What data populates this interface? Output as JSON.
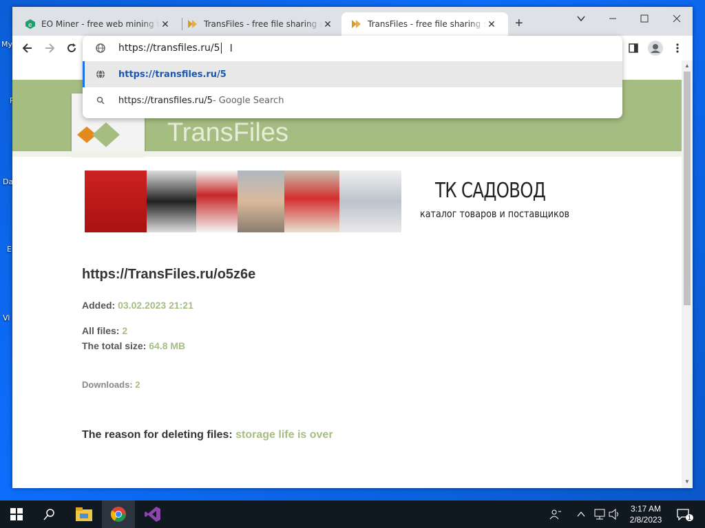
{
  "desktop": {
    "labels": [
      "My",
      "R",
      "Da",
      "E",
      "Vi"
    ]
  },
  "browser": {
    "tabs": [
      {
        "title": "EO Miner - free web mining tool",
        "icon": "eo-miner-icon"
      },
      {
        "title": "TransFiles - free file sharing service",
        "icon": "transfiles-icon"
      },
      {
        "title": "TransFiles - free file sharing service",
        "icon": "transfiles-icon"
      }
    ],
    "address": {
      "value": "https://transfiles.ru/5"
    },
    "suggestions": [
      {
        "text": "https://transfiles.ru/5",
        "suffix": ""
      },
      {
        "text": "https://transfiles.ru/5",
        "suffix": " - Google Search"
      }
    ]
  },
  "page": {
    "banner_text": "TransFiles",
    "ad_title": "ТК САДОВОД",
    "ad_subtitle": "каталог товаров и поставщиков",
    "file_link": "https://TransFiles.ru/o5z6e",
    "added_label": "Added:",
    "added_value": "03.02.2023 21:21",
    "all_files_label": "All files:",
    "all_files_value": "2",
    "total_size_label": "The total size:",
    "total_size_value": "64.8 MB",
    "downloads_label": "Downloads:",
    "downloads_value": "2",
    "reason_label": "The reason for deleting files:",
    "reason_value": "storage life is over"
  },
  "taskbar": {
    "time": "3:17 AM",
    "date": "2/8/2023",
    "notification_count": "1"
  },
  "colors": {
    "accent": "#a6bd82",
    "link_blue": "#1a73e8"
  }
}
